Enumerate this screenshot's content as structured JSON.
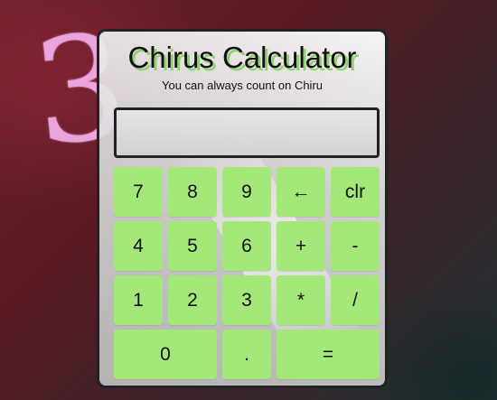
{
  "background": {
    "chalk_digit": "3"
  },
  "calculator": {
    "title": "Chirus Calculator",
    "subtitle": "You can always count on Chiru",
    "display_value": "",
    "accent_color": "#a4e879",
    "title_shadow_color": "#8ed16f",
    "buttons": {
      "seven": "7",
      "eight": "8",
      "nine": "9",
      "backspace": "←",
      "clear": "clr",
      "four": "4",
      "five": "5",
      "six": "6",
      "plus": "+",
      "minus": "-",
      "one": "1",
      "two": "2",
      "three": "3",
      "multiply": "*",
      "divide": "/",
      "zero": "0",
      "decimal": ".",
      "equals": "="
    }
  }
}
